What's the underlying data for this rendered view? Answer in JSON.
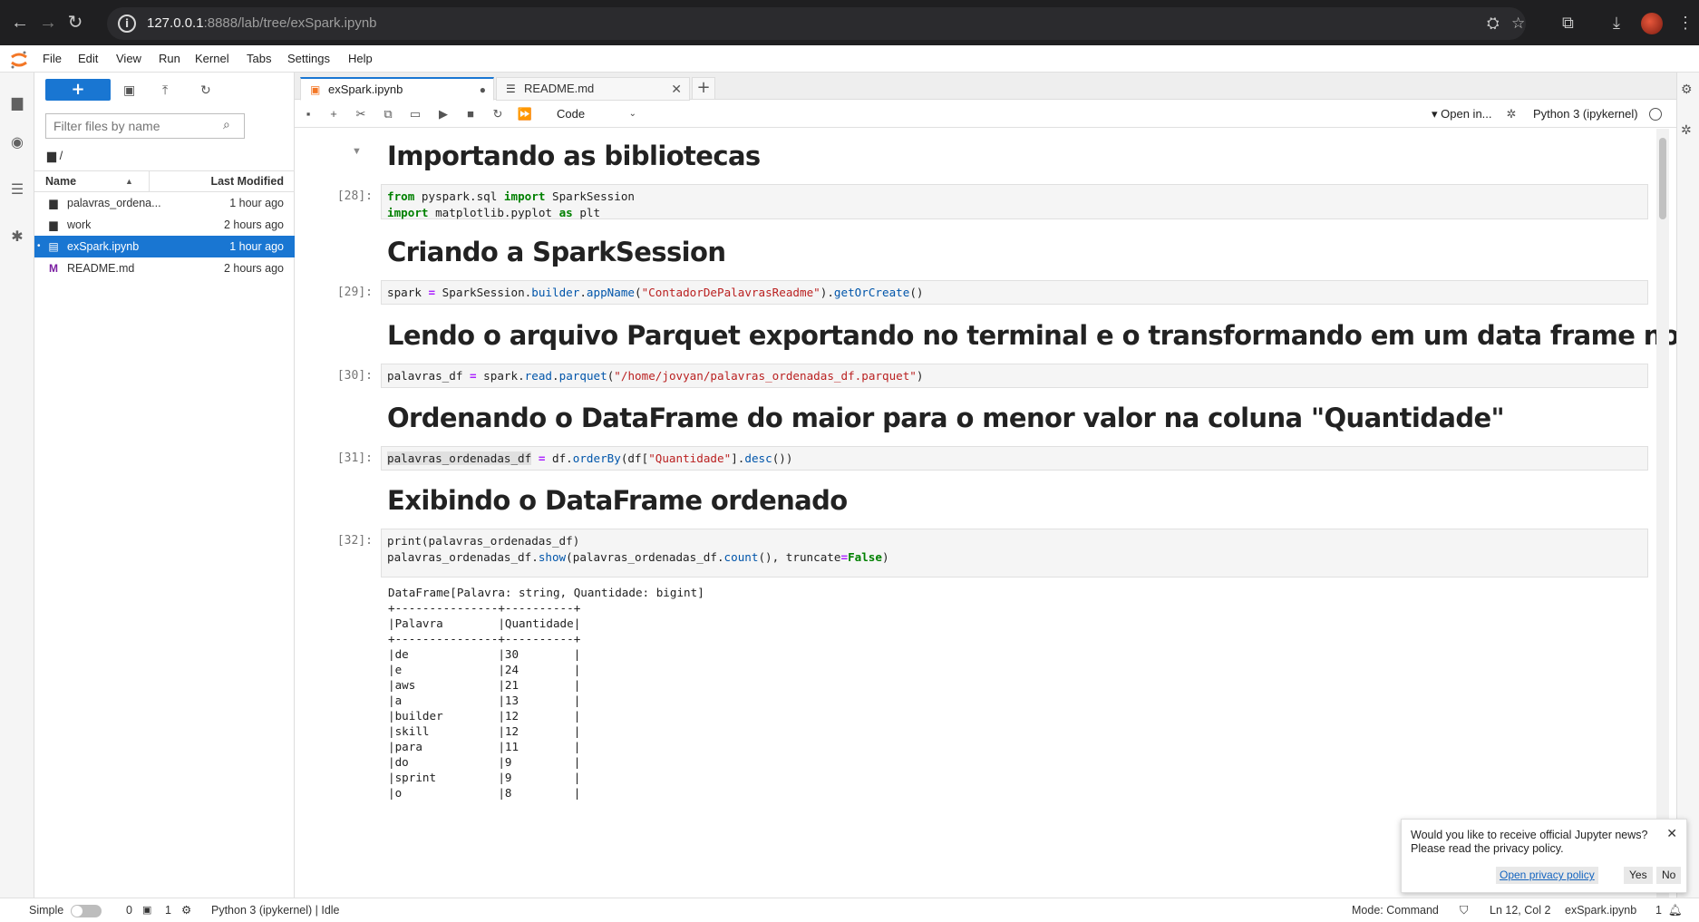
{
  "browser": {
    "url_host": "127.0.0.1",
    "url_rest": ":8888/lab/tree/exSpark.ipynb"
  },
  "menu": [
    "File",
    "Edit",
    "View",
    "Run",
    "Kernel",
    "Tabs",
    "Settings",
    "Help"
  ],
  "filebrowser": {
    "new_label": "+",
    "filter_placeholder": "Filter files by name",
    "breadcrumb": "/",
    "col_name": "Name",
    "col_modified": "Last Modified",
    "files": [
      {
        "name": "palavras_ordena...",
        "modified": "1 hour ago"
      },
      {
        "name": "work",
        "modified": "2 hours ago"
      },
      {
        "name": "exSpark.ipynb",
        "modified": "1 hour ago"
      },
      {
        "name": "README.md",
        "modified": "2 hours ago"
      }
    ]
  },
  "tabs": [
    {
      "label": "exSpark.ipynb"
    },
    {
      "label": "README.md"
    }
  ],
  "toolbar": {
    "cell_type": "Code",
    "open_in": "Open in...",
    "kernel": "Python 3 (ipykernel)"
  },
  "notebook": {
    "h1": "Importando as bibliotecas",
    "p1": "[28]:",
    "h2": "Criando a SparkSession",
    "p2": "[29]:",
    "h3": "Lendo o arquivo Parquet exportando no terminal e o transformando em um data frame novamente",
    "p3": "[30]:",
    "h4": "Ordenando o DataFrame do maior para o menor valor na coluna \"Quantidade\"",
    "p4": "[31]:",
    "h5": "Exibindo o DataFrame ordenado",
    "p5": "[32]:",
    "output": "DataFrame[Palavra: string, Quantidade: bigint]\n+---------------+----------+\n|Palavra        |Quantidade|\n+---------------+----------+\n|de             |30        |\n|e              |24        |\n|aws            |21        |\n|a              |13        |\n|builder        |12        |\n|skill          |12        |\n|para           |11        |\n|do             |9         |\n|sprint         |9         |\n|o              |8         |"
  },
  "status": {
    "mode_toggle": "Simple",
    "terminals": "0",
    "kernels": "1",
    "kernel_status": "Python 3 (ipykernel) | Idle",
    "mode": "Mode: Command",
    "position": "Ln 12, Col 2",
    "filename": "exSpark.ipynb",
    "notifications": "1"
  },
  "notification": {
    "message": "Would you like to receive official Jupyter news? Please read the privacy policy.",
    "link": "Open privacy policy",
    "yes": "Yes",
    "no": "No"
  },
  "colors": {
    "accent": "#1976d2",
    "chrome": "#1f1f21"
  },
  "icons": [
    "back-arrow-icon",
    "forward-arrow-icon",
    "reload-icon",
    "site-info-icon",
    "translate-icon",
    "star-icon",
    "extensions-icon",
    "download-icon",
    "menu-icon",
    "folder-icon",
    "running-icon",
    "toc-icon",
    "puzzle-icon",
    "upload-icon",
    "refresh-icon",
    "search-icon",
    "save-icon",
    "cut-icon",
    "copy-icon",
    "paste-icon",
    "run-icon",
    "stop-icon",
    "restart-icon",
    "fast-forward-icon",
    "bug-icon",
    "gear-icon",
    "bell-icon"
  ]
}
